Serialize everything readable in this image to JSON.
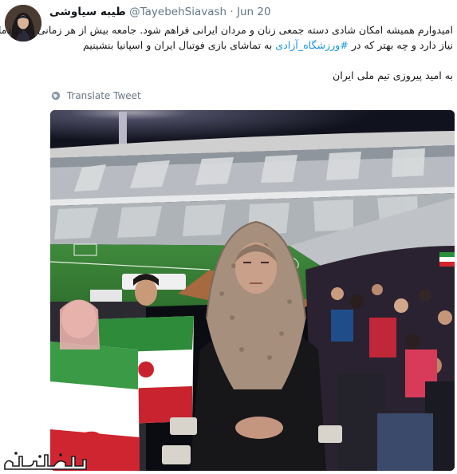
{
  "tweet": {
    "author_name": "طیبه سیاوشی",
    "handle": "@TayebehSiavash",
    "separator": "·",
    "date": "Jun 20",
    "text_line1": "امیدوارم همیشه امکان شادی دسته جمعی زنان و مردان ایرانی فراهم شود. جامعه بیش از هر زمانی به شادمانی",
    "text_line2_before": "نیاز دارد و چه بهتر که در",
    "hashtag": "#ورزشگاه_آزادی",
    "text_line2_after": "به تماشای بازی فوتبال ایران و اسپانیا بنشینیم",
    "text_line3": "به امید پیروزی تیم ملی ایران",
    "translate_label": "Translate Tweet"
  },
  "colors": {
    "link": "#1b95e0",
    "secondary_text": "#657786",
    "primary_text": "#14171a"
  },
  "icons": {
    "translate": "globe-icon"
  },
  "watermark": {
    "text": "جوانآنلاین"
  }
}
